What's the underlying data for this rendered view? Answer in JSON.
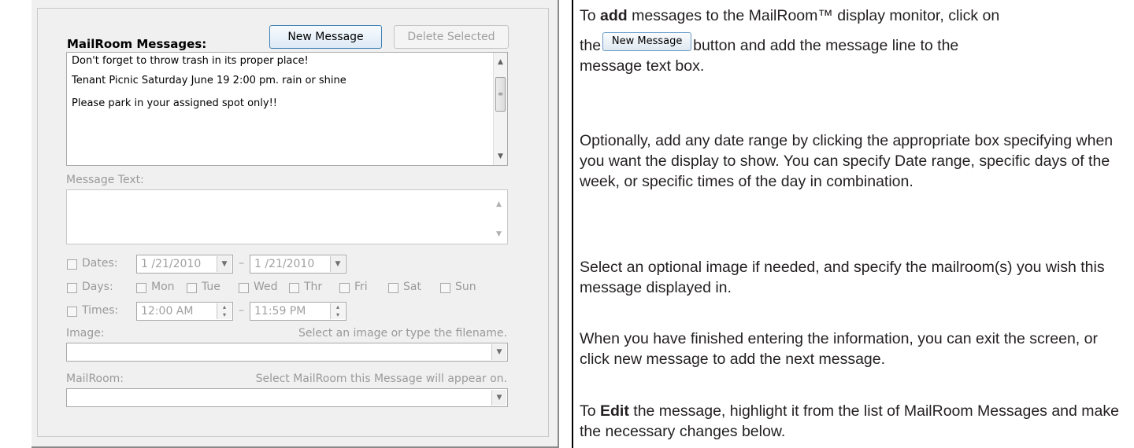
{
  "dialog": {
    "messages_title": "MailRoom Messages:",
    "new_message_button": "New Message",
    "delete_selected_button": "Delete Selected",
    "messages": [
      "Don't forget to throw trash in its proper place!",
      "Tenant Picnic Saturday June 19 2:00 pm. rain or shine",
      "Please park in your assigned spot only!!"
    ],
    "message_text_label": "Message Text:",
    "message_text_value": "",
    "dates_label": "Dates:",
    "date_from": "1 /21/2010",
    "date_to": "1 /21/2010",
    "days_label": "Days:",
    "days": [
      "Mon",
      "Tue",
      "Wed",
      "Thr",
      "Fri",
      "Sat",
      "Sun"
    ],
    "times_label": "Times:",
    "time_from": "12:00 AM",
    "time_to": "11:59 PM",
    "range_separator": "–",
    "image_label": "Image:",
    "image_hint": "Select an image or type the filename.",
    "image_value": "",
    "mailroom_label": "MailRoom:",
    "mailroom_hint": "Select MailRoom this Message will appear on.",
    "mailroom_value": ""
  },
  "help": {
    "p1_before": "To ",
    "p1_bold": "add",
    "p1_after": " messages to the MailRoom™ display monitor, click on",
    "p1_line2_before": "the",
    "p1_button": "New Message",
    "p1_line2_after": "button and add the message line to the",
    "p1_line3": "message text box.",
    "p2": "Optionally, add any date range by clicking the appropriate box specifying when you want the display to show. You can specify Date range, specific days of the week, or specific times of the day in combination.",
    "p3": "Select an optional image if needed, and specify the mailroom(s) you wish this message displayed in.",
    "p4": "When you have finished entering the information, you can exit the screen, or click new message to add the next message.",
    "p5_before": "To ",
    "p5_bold": "Edit",
    "p5_after": " the message, highlight it from the list of MailRoom Messages and make the necessary changes below."
  }
}
